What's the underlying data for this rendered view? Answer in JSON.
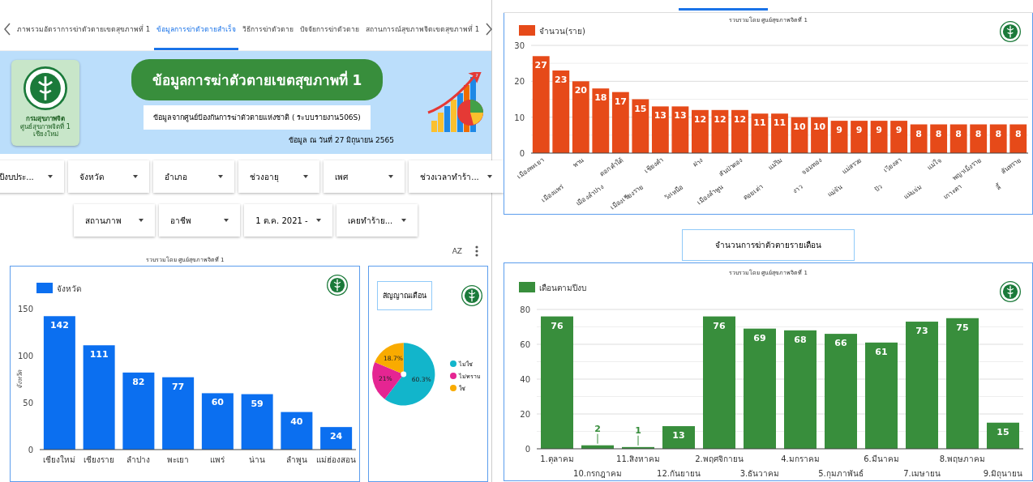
{
  "tabs": [
    {
      "label": "ภาพรวมอัตราการฆ่าตัวตายเขตสุขภาพที่ 1",
      "selected": false
    },
    {
      "label": "ข้อมูลการฆ่าตัวตายสำเร็จ",
      "selected": true
    },
    {
      "label": "วิธีการฆ่าตัวตาย",
      "selected": false
    },
    {
      "label": "ปัจจัยการฆ่าตัวตาย",
      "selected": false
    },
    {
      "label": "สถานการณ์สุขภาพจิตเขตสุขภาพที่ 1",
      "selected": false
    }
  ],
  "header": {
    "logo_title": "กรมสุขภาพจิต",
    "logo_subtitle": "ศูนย์สุขภาพจิตที่ 1 เชียงใหม่",
    "title": "ข้อมูลการฆ่าตัวตายเขตสุขภาพที่ 1",
    "subtitle": "ข้อมูลจากศูนย์ป้องกันการฆ่าตัวตายแห่งชาติ ( ระบบรายงาน506S)",
    "date": "ข้อมูล ณ วันที่ 27 มิถุนายน 2565"
  },
  "filters": [
    [
      {
        "label": "ปีงบประ..."
      },
      {
        "label": "จังหวัด"
      },
      {
        "label": "อำเภอ"
      },
      {
        "label": "ช่วงอายุ"
      },
      {
        "label": "เพศ"
      },
      {
        "label": "ช่วงเวลาทำร้า..."
      }
    ],
    [
      {
        "label": "สถานภาพ"
      },
      {
        "label": "อาชีพ"
      },
      {
        "label": "1 ต.ค. 2021 -"
      },
      {
        "label": "เคยทำร้าย..."
      }
    ]
  ],
  "toolbar": {
    "sort_label": "AZ"
  },
  "province_chart": {
    "caption": "รวบรวมโดย ศูนย์สุขภาพจิตที่ 1",
    "chart_data": {
      "type": "bar",
      "ylabel": "จังหวัด",
      "categories": [
        "เชียงใหม่",
        "เชียงราย",
        "ลำปาง",
        "พะเยา",
        "แพร่",
        "น่าน",
        "ลำพูน",
        "แม่ฮ่องสอน"
      ],
      "series": [
        {
          "name": "จังหวัด",
          "color": "#0b6ff0",
          "values": [
            142,
            111,
            82,
            77,
            60,
            59,
            40,
            24
          ]
        }
      ],
      "ylim": [
        0,
        150
      ],
      "yticks": [
        0,
        50,
        100,
        150
      ],
      "grid": false,
      "data_labels": true
    }
  },
  "warning_chart": {
    "title": "สัญญาณเตือน",
    "chart_data": {
      "type": "pie",
      "categories": [
        "ไม่ใช่",
        "ไม่ทราบ",
        "ใช่"
      ],
      "series": [
        {
          "values": [
            60.3,
            21,
            18.7
          ]
        }
      ],
      "colors": [
        "#12b5cb",
        "#e52592",
        "#f9ab00"
      ],
      "value_labels": [
        "60.3%",
        "21%",
        "18.7%"
      ]
    }
  },
  "district_chart": {
    "caption": "รวบรวมโดย ศูนย์สุขภาพจิตที่ 1",
    "chart_data": {
      "type": "bar",
      "categories": [
        "เมืองพะเยา",
        "เมืองแพร่",
        "พาน",
        "เมืองลำปาง",
        "ดอกคำใต้",
        "เมืองเชียงราย",
        "เชียงคำ",
        "วังเหนือ",
        "ฝาง",
        "เมืองลำพูน",
        "สันป่าตอง",
        "ดอยเต่า",
        "แม่ริม",
        "งาว",
        "จอมทอง",
        "แม่จัน",
        "แม่สรวย",
        "ปัว",
        "เวียงสา",
        "แม่แจ่ม",
        "แม่ใจ",
        "เกาะคา",
        "พญาเม็งราย",
        "ลี้",
        "สันทราย"
      ],
      "series": [
        {
          "name": "จำนวน(ราย)",
          "color": "#e64a19",
          "values": [
            27,
            23,
            20,
            18,
            17,
            15,
            13,
            13,
            12,
            12,
            12,
            11,
            11,
            10,
            10,
            9,
            9,
            9,
            9,
            8,
            8,
            8,
            8,
            8,
            8
          ]
        }
      ],
      "ylim": [
        0,
        30
      ],
      "yticks": [
        0,
        10,
        20,
        30
      ],
      "grid": true,
      "data_labels": true
    }
  },
  "monthly_title": "จำนวนการฆ่าตัวตายรายเดือน",
  "monthly_chart": {
    "caption": "รวบรวมโดย ศูนย์สุขภาพจิตที่ 1",
    "chart_data": {
      "type": "bar",
      "categories": [
        "1.ตุลาคม",
        "10.กรกฎาคม",
        "11.สิงหาคม",
        "12.กันยายน",
        "2.พฤศจิกายน",
        "3.ธันวาคม",
        "4.มกราคม",
        "5.กุมภาพันธ์",
        "6.มีนาคม",
        "7.เมษายน",
        "8.พฤษภาคม",
        "9.มิถุนายน"
      ],
      "series": [
        {
          "name": "เดือนตามปีงบ",
          "color": "#388e3c",
          "values": [
            76,
            2,
            1,
            13,
            76,
            69,
            68,
            66,
            61,
            73,
            75,
            15
          ]
        }
      ],
      "ylim": [
        0,
        80
      ],
      "yticks": [
        0,
        20,
        40,
        60,
        80
      ],
      "grid": true,
      "data_labels": true
    }
  }
}
